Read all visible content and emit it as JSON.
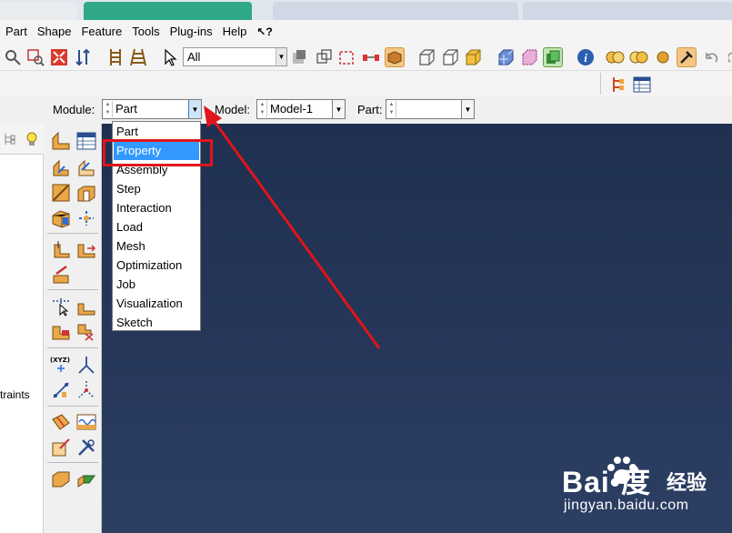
{
  "menu": {
    "items": [
      "Part",
      "Shape",
      "Feature",
      "Tools",
      "Plug-ins",
      "Help"
    ],
    "whats_this": "↖?"
  },
  "toolbar": {
    "selection_filter": "All"
  },
  "module_bar": {
    "module_label": "Module:",
    "module_value": "Part",
    "model_label": "Model:",
    "model_value": "Model-1",
    "part_label": "Part:",
    "part_value": ""
  },
  "module_dropdown": {
    "options": [
      "Part",
      "Property",
      "Assembly",
      "Step",
      "Interaction",
      "Load",
      "Mesh",
      "Optimization",
      "Job",
      "Visualization",
      "Sketch"
    ],
    "highlighted": "Property"
  },
  "left_panel": {
    "partial_text": "traints"
  },
  "watermark": {
    "logo": "Bai•度",
    "cn_text": "经验",
    "url": "jingyan.baidu.com"
  },
  "colors": {
    "viewport_bg": "#243559",
    "highlight": "#3399ff",
    "annotation_red": "#e0141c"
  }
}
